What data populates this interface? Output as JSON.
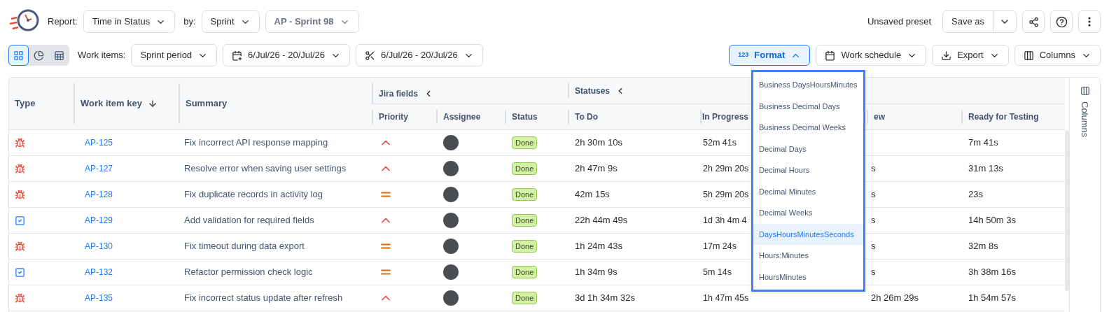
{
  "toolbar": {
    "report_label": "Report:",
    "report": "Time in Status",
    "by_label": "by:",
    "by": "Sprint",
    "sprint": "AP - Sprint 98",
    "preset": "Unsaved preset",
    "save_as": "Save as"
  },
  "views": [
    {
      "kind": "grid",
      "selected": true
    },
    {
      "kind": "pie",
      "selected": false
    },
    {
      "kind": "table",
      "selected": false
    }
  ],
  "filters": {
    "work_items_label": "Work items:",
    "work_items": "Sprint period",
    "date_range": "6/Jul/26 - 20/Jul/26",
    "cut_range": "6/Jul/26 - 20/Jul/26"
  },
  "actions": [
    {
      "kind": "format",
      "label": "Format",
      "expanded": true
    },
    {
      "kind": "schedule",
      "label": "Work schedule",
      "expanded": false
    },
    {
      "kind": "export",
      "label": "Export",
      "expanded": false
    },
    {
      "kind": "columns",
      "label": "Columns",
      "expanded": false
    }
  ],
  "format_icon": "123",
  "format_menu": [
    {
      "label": "Business DaysHoursMinutes",
      "selected": false
    },
    {
      "label": "Business Decimal Days",
      "selected": false
    },
    {
      "label": "Business Decimal Weeks",
      "selected": false
    },
    {
      "label": "Decimal Days",
      "selected": false
    },
    {
      "label": "Decimal Hours",
      "selected": false
    },
    {
      "label": "Decimal Minutes",
      "selected": false
    },
    {
      "label": "Decimal Weeks",
      "selected": false
    },
    {
      "label": "DaysHoursMinutesSeconds",
      "selected": true
    },
    {
      "label": "Hours:Minutes",
      "selected": false
    },
    {
      "label": "HoursMinutes",
      "selected": false
    }
  ],
  "table": {
    "groups": {
      "jira": "Jira fields",
      "statuses": "Statuses"
    },
    "columns": [
      "Type",
      "Work item key",
      "Summary",
      "Priority",
      "Assignee",
      "Status",
      "To Do",
      "In Progress",
      "ew",
      "Ready for Testing"
    ],
    "rows": [
      {
        "kind": "bug",
        "key": "AP-125",
        "summary": "Fix incorrect API response mapping",
        "priority": {
          "kind": "high"
        },
        "status": "Done",
        "to_do": "2h 30m 10s",
        "in_progress": "52m 41s",
        "ready": "7m 41s"
      },
      {
        "kind": "bug",
        "key": "AP-127",
        "summary": "Resolve error when saving user settings",
        "priority": {
          "kind": "high"
        },
        "status": "Done",
        "to_do": "2h 47m 9s",
        "in_progress": "2h 29m 20s",
        "in_review": "s",
        "ready": "31m 13s"
      },
      {
        "kind": "bug",
        "key": "AP-128",
        "summary": "Fix duplicate records in activity log",
        "priority": {
          "kind": "medium"
        },
        "status": "Done",
        "to_do": "42m 15s",
        "in_progress": "5h 29m 20s",
        "in_review": "s",
        "ready": "23s"
      },
      {
        "kind": "task",
        "key": "AP-129",
        "summary": "Add validation for required fields",
        "priority": {
          "kind": "high"
        },
        "status": "Done",
        "to_do": "22h 44m 49s",
        "in_progress": "1d 3h 4m 4",
        "in_review": "s",
        "ready": "14h 50m 3s"
      },
      {
        "kind": "bug",
        "key": "AP-130",
        "summary": "Fix timeout during data export",
        "priority": {
          "kind": "medium"
        },
        "status": "Done",
        "to_do": "1h 24m 43s",
        "in_progress": "17m 24s",
        "in_review": "s",
        "ready": "32m 8s"
      },
      {
        "kind": "task",
        "key": "AP-132",
        "summary": "Refactor permission check logic",
        "priority": {
          "kind": "medium"
        },
        "status": "Done",
        "to_do": "1h 34m 9s",
        "in_progress": "5m 14s",
        "in_review": "s",
        "ready": "3h 38m 16s"
      },
      {
        "kind": "bug",
        "key": "AP-135",
        "summary": "Fix incorrect status update after refresh",
        "priority": {
          "kind": "high"
        },
        "status": "Done",
        "to_do": "3d 1h 34m 32s",
        "in_progress": "1h 47m 45s",
        "in_review": "2h 26m 29s",
        "ready": "1h 54m 57s"
      }
    ]
  },
  "side_panel": "Columns"
}
